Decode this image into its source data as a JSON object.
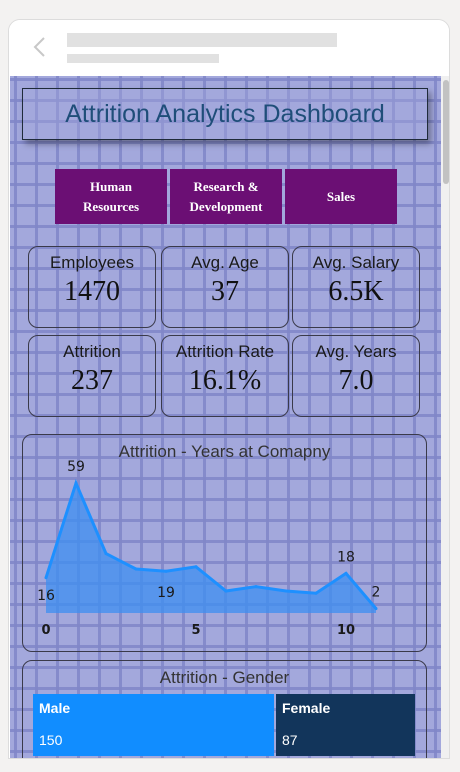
{
  "header": {
    "back_icon": "chevron-left-icon"
  },
  "dashboard": {
    "title": "Attrition Analytics Dashboard",
    "departments": [
      "Human\nResources",
      "Research &\nDevelopment",
      "Sales"
    ],
    "kpis": [
      {
        "label": "Employees",
        "value": "1470"
      },
      {
        "label": "Avg. Age",
        "value": "37"
      },
      {
        "label": "Avg. Salary",
        "value": "6.5K"
      },
      {
        "label": "Attrition",
        "value": "237"
      },
      {
        "label": "Attrition Rate",
        "value": "16.1%"
      },
      {
        "label": "Avg. Years",
        "value": "7.0"
      }
    ],
    "years_chart_title": "Attrition - Years at Comapny",
    "gender_chart_title": "Attrition - Gender"
  },
  "chart_data": [
    {
      "type": "area",
      "title": "Attrition - Years at Comapny",
      "x": [
        0,
        1,
        2,
        3,
        4,
        5,
        6,
        7,
        8,
        9,
        10,
        11
      ],
      "values": [
        16,
        59,
        27,
        20,
        19,
        21,
        10,
        12,
        10,
        9,
        18,
        2
      ],
      "data_labels": [
        {
          "x": 0,
          "text": "16"
        },
        {
          "x": 1,
          "text": "59"
        },
        {
          "x": 4,
          "text": "19"
        },
        {
          "x": 10,
          "text": "18"
        },
        {
          "x": 11,
          "text": "2"
        }
      ],
      "x_ticks": [
        "0",
        "5",
        "10"
      ],
      "ylim": [
        0,
        65
      ],
      "color": "#1e90ff"
    },
    {
      "type": "treemap",
      "title": "Attrition - Gender",
      "categories": [
        "Male",
        "Female"
      ],
      "values": [
        150,
        87
      ],
      "colors": [
        "#118dff",
        "#12355b"
      ]
    }
  ]
}
